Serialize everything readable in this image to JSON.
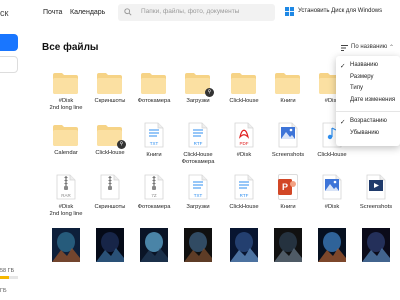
{
  "header": {
    "logo_fragment": "ск",
    "nav": [
      "Почта",
      "Календарь"
    ],
    "search_placeholder": "Папки, файлы, фото, документы",
    "install_label": "Установить Диск для Windows"
  },
  "sidebar": {
    "usage_text": "58 ГБ",
    "usage_fraction": 0.5,
    "bottom_text": "ГБ"
  },
  "main": {
    "title": "Все файлы",
    "sort_label": "По названию"
  },
  "sort_menu": {
    "sort_by": [
      {
        "label": "Названию",
        "checked": true
      },
      {
        "label": "Размеру",
        "checked": false
      },
      {
        "label": "Типу",
        "checked": false
      },
      {
        "label": "Дате изменения",
        "checked": false
      }
    ],
    "order": [
      {
        "label": "Возрастанию",
        "checked": true
      },
      {
        "label": "Убыванию",
        "checked": false
      }
    ]
  },
  "files": [
    [
      {
        "name": "#Disk\n2nd long line",
        "kind": "folder",
        "icon": "folder-icon"
      },
      {
        "name": "Скриншоты",
        "kind": "folder",
        "icon": "folder-icon"
      },
      {
        "name": "Фотокамера",
        "kind": "folder",
        "icon": "folder-icon"
      },
      {
        "name": "Загрузки",
        "kind": "folder",
        "icon": "folder-icon",
        "shared": true
      },
      {
        "name": "ClickHouse",
        "kind": "folder",
        "icon": "folder-icon"
      },
      {
        "name": "Книги",
        "kind": "folder",
        "icon": "folder-icon"
      },
      {
        "name": "#Disk",
        "kind": "folder",
        "icon": "folder-icon"
      }
    ],
    [
      {
        "name": "Calendar",
        "kind": "folder",
        "icon": "folder-icon"
      },
      {
        "name": "ClickHouse",
        "kind": "folder",
        "icon": "folder-icon",
        "shared": true
      },
      {
        "name": "Книги",
        "kind": "doc",
        "icon": "txt-file-icon",
        "tag": "TXT",
        "color": "#2f8ff0"
      },
      {
        "name": "ClickHouse\nФотокамера",
        "kind": "doc",
        "icon": "rtf-file-icon",
        "tag": "RTF",
        "color": "#2f8ff0"
      },
      {
        "name": "#Disk",
        "kind": "doc",
        "icon": "pdf-file-icon",
        "tag": "PDF",
        "color": "#e02020"
      },
      {
        "name": "Screenshots",
        "kind": "doc",
        "icon": "image-file-icon",
        "tag": "",
        "color": "#3d74d8"
      },
      {
        "name": "ClickHouse",
        "kind": "doc",
        "icon": "audio-file-icon",
        "tag": "",
        "color": "#2f8ff0"
      }
    ],
    [
      {
        "name": "#Disk\n2nd long line",
        "kind": "doc",
        "icon": "archive-file-icon",
        "tag": "RAR",
        "color": "#888888"
      },
      {
        "name": "Скриншоты",
        "kind": "doc",
        "icon": "archive-file-icon",
        "tag": "",
        "color": "#888888"
      },
      {
        "name": "Фотокамера",
        "kind": "doc",
        "icon": "archive-file-icon",
        "tag": "7Z",
        "color": "#888888"
      },
      {
        "name": "Загрузки",
        "kind": "doc",
        "icon": "txt-file-icon",
        "tag": "TXT",
        "color": "#2f8ff0"
      },
      {
        "name": "ClickHouse",
        "kind": "doc",
        "icon": "rtf-file-icon",
        "tag": "RTF",
        "color": "#2f8ff0"
      },
      {
        "name": "Книги",
        "kind": "doc",
        "icon": "presentation-file-icon",
        "tag": "",
        "color": "#d24726"
      },
      {
        "name": "#Disk",
        "kind": "doc",
        "icon": "image-file-icon",
        "tag": "",
        "color": "#3d74d8"
      },
      {
        "name": "Screenshots",
        "kind": "doc",
        "icon": "video-file-icon",
        "tag": "",
        "color": "#1f3a6b"
      }
    ],
    [
      {
        "name": "",
        "kind": "photo",
        "icon": "photo-thumbnail",
        "variant": 0
      },
      {
        "name": "",
        "kind": "photo",
        "icon": "photo-thumbnail",
        "variant": 1
      },
      {
        "name": "",
        "kind": "photo",
        "icon": "photo-thumbnail",
        "variant": 2
      },
      {
        "name": "",
        "kind": "photo",
        "icon": "photo-thumbnail",
        "variant": 3
      },
      {
        "name": "",
        "kind": "photo",
        "icon": "photo-thumbnail",
        "variant": 4
      },
      {
        "name": "",
        "kind": "photo",
        "icon": "photo-thumbnail",
        "variant": 5
      },
      {
        "name": "",
        "kind": "photo",
        "icon": "photo-thumbnail",
        "variant": 6
      },
      {
        "name": "",
        "kind": "photo",
        "icon": "photo-thumbnail",
        "variant": 7
      }
    ]
  ],
  "colors": {
    "accent": "#1976ff",
    "folder": "#fbe0a2",
    "folder_tab": "#f6d386",
    "search_bg": "#f2f2f2"
  }
}
